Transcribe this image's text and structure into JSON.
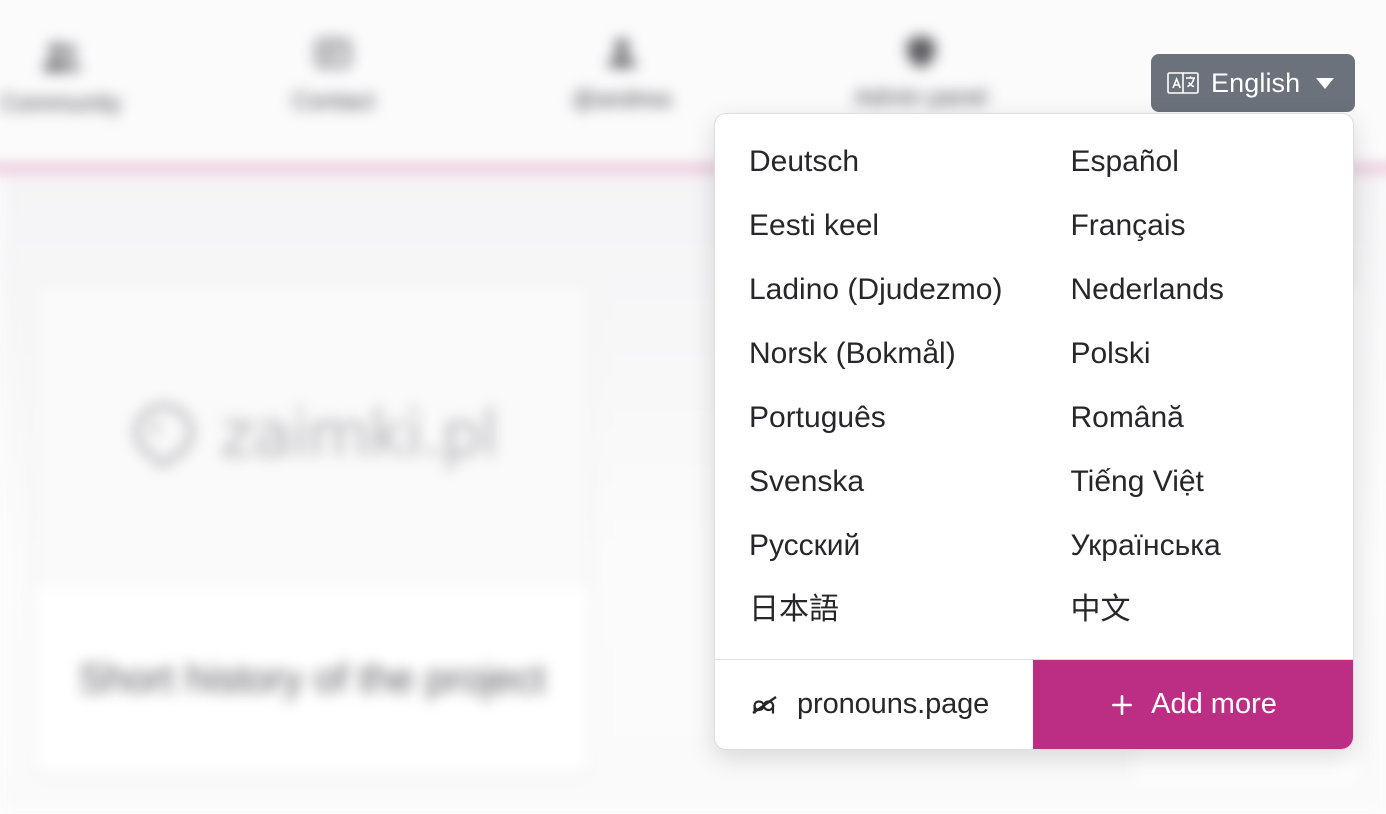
{
  "navbar": {
    "items": [
      {
        "label": "Community",
        "icon": "community-icon"
      },
      {
        "label": "Contact",
        "icon": "contact-icon"
      },
      {
        "label": "@andrea",
        "icon": "user-icon"
      },
      {
        "label": "Admin panel",
        "icon": "admin-panel-icon"
      }
    ],
    "accent_color": "#cf7ba8"
  },
  "page": {
    "card": {
      "logo_text": "zaimki.pl",
      "title": "Short history of the project"
    }
  },
  "language_selector": {
    "button": {
      "label": "English",
      "icon": "translate-icon",
      "caret": "chevron-down-icon",
      "background_color": "#6c727c"
    },
    "expanded": true,
    "options": [
      "Deutsch",
      "Español",
      "Eesti keel",
      "Français",
      "Ladino (Djudezmo)",
      "Nederlands",
      "Norsk (Bokmål)",
      "Polski",
      "Português",
      "Română",
      "Svenska",
      "Tiếng Việt",
      "Русский",
      "Українська",
      "日本語",
      "中文"
    ],
    "footer": {
      "brand_label": "pronouns.page",
      "brand_icon": "pronouns-page-logo-icon",
      "add_more_label": "Add more",
      "add_more_icon": "plus-icon",
      "add_more_color": "#bc2e83"
    }
  }
}
